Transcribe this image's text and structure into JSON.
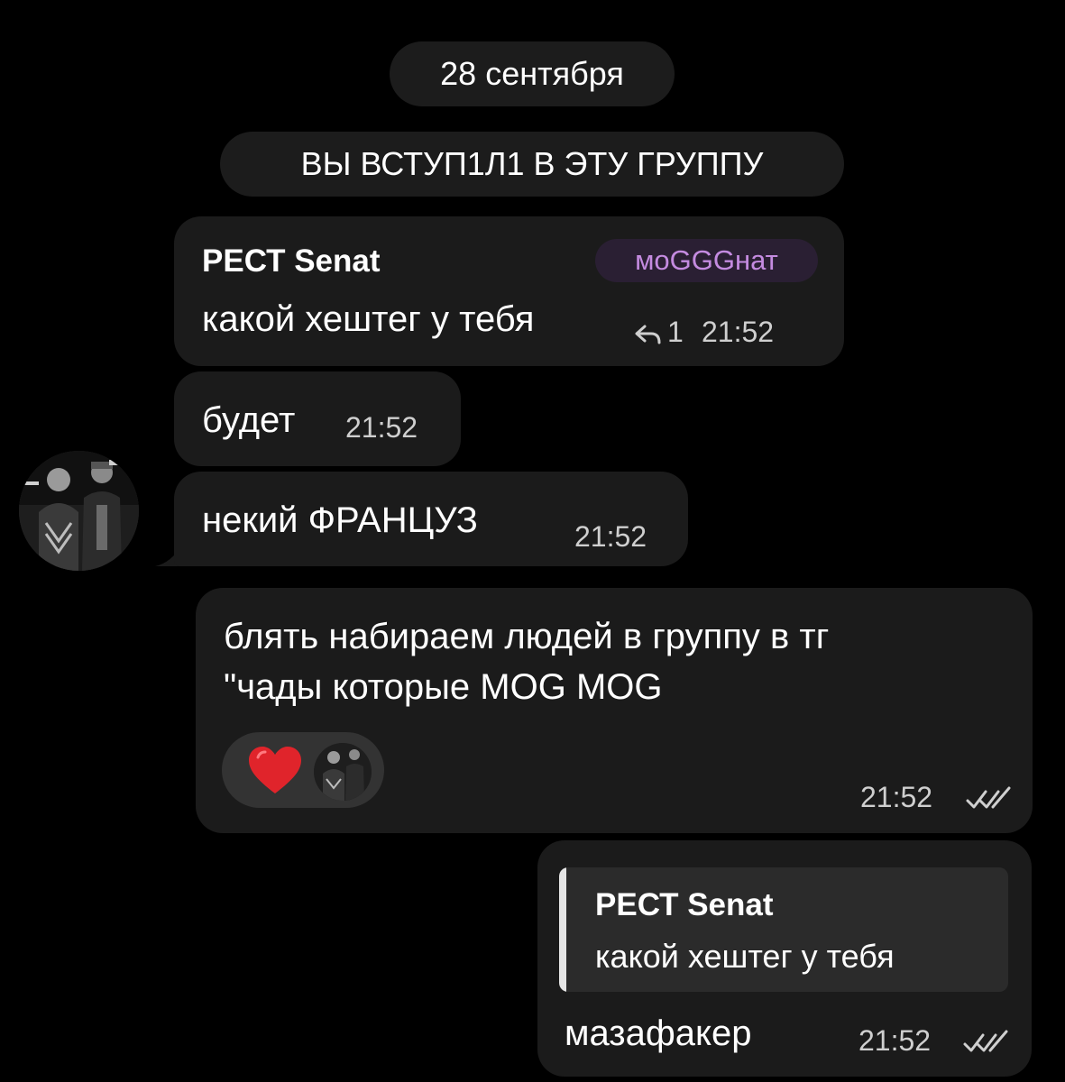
{
  "chat": {
    "date_separator": "28 сентября",
    "service_message": "ВЫ ВСТУП1Л1 В ЭТУ ГРУППУ",
    "messages": [
      {
        "sender": "РЕСТ Senat",
        "tag": "моGGGнат",
        "text": "какой хештег у тебя",
        "reply_count": "1",
        "time": "21:52"
      },
      {
        "text": "будет",
        "time": "21:52"
      },
      {
        "text": "некий ФРАНЦУЗ",
        "time": "21:52"
      },
      {
        "line1": "блять набираем людей в группу в тг",
        "line2": "\"чады которые MOG MOG",
        "reaction": "heart",
        "time": "21:52",
        "status": "read"
      },
      {
        "quote_sender": "РЕСТ Senat",
        "quote_text": "какой хештег у тебя",
        "text": "мазафакер",
        "time": "21:52",
        "status": "read"
      }
    ]
  },
  "colors": {
    "background": "#000000",
    "bubble": "#1b1b1b",
    "tag_text": "#c48be0",
    "heart": "#e0242b"
  }
}
